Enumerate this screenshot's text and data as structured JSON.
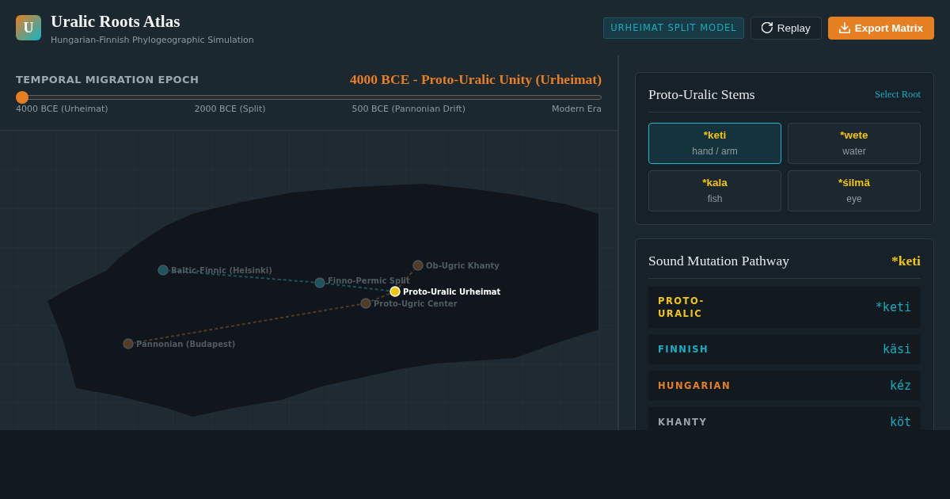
{
  "header": {
    "logo": "U",
    "title": "Uralic Roots Atlas",
    "subtitle": "Hungarian-Finnish Phylogeographic Simulation",
    "model_badge": "URHEIMAT SPLIT MODEL",
    "buttons": [
      {
        "label": "Replay",
        "kind": "secondary"
      },
      {
        "label": "Export Matrix",
        "kind": "primary"
      }
    ]
  },
  "epoch": {
    "heading": "TEMPORAL MIGRATION EPOCH",
    "current": "4000 BCE - Proto-Uralic Unity (Urheimat)",
    "slider": {
      "level": 0
    },
    "ticks": [
      "4000 BCE (Urheimat)",
      "2000 BCE (Split)",
      "500 BCE (Pannonian Drift)",
      "Modern Era"
    ]
  },
  "map": {
    "sites": [
      {
        "name": "Proto-Uralic Urheimat",
        "color": "#f1c40f",
        "active": true,
        "children": [
          {
            "name": "Finno-Permic Split",
            "color": "#1a5562",
            "active": false,
            "children": [
              {
                "name": "Baltic-Finnic (Helsinki)",
                "color": "#1a5562",
                "active": false
              }
            ]
          },
          {
            "name": "Proto-Ugric Center",
            "color": "#553a24",
            "active": false,
            "children": [
              {
                "name": "Pannonian (Budapest)",
                "color": "#553a24",
                "active": false
              }
            ]
          },
          {
            "name": "Ob-Ugric Khanty",
            "color": "#553a24",
            "active": false
          }
        ]
      }
    ]
  },
  "stems": {
    "title": "Proto-Uralic Stems",
    "action": "Select Root",
    "items": [
      {
        "root": "*keti",
        "meaning": "hand / arm",
        "selected": true
      },
      {
        "root": "*wete",
        "meaning": "water",
        "selected": false
      },
      {
        "root": "*kala",
        "meaning": "fish",
        "selected": false
      },
      {
        "root": "*śilmä",
        "meaning": "eye",
        "selected": false
      }
    ]
  },
  "pathway": {
    "title": "Sound Mutation Pathway",
    "root": "*keti",
    "rows": [
      {
        "language": "PROTO-URALIC",
        "form": "*keti",
        "color": "#f1c40f"
      },
      {
        "language": "FINNISH",
        "form": "käsi",
        "color": "#17b0c5"
      },
      {
        "language": "HUNGARIAN",
        "form": "kéz",
        "color": "#e67e22"
      },
      {
        "language": "KHANTY",
        "form": "köt",
        "color": "#9aa3a8"
      }
    ]
  }
}
